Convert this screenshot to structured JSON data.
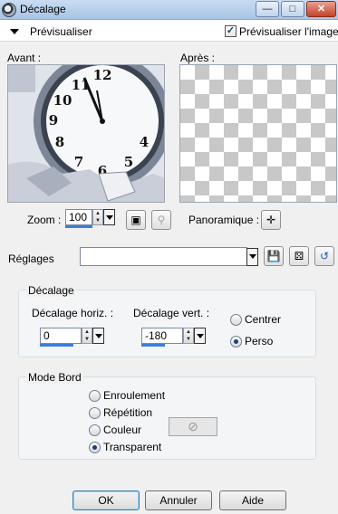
{
  "window": {
    "title": "Décalage"
  },
  "preview": {
    "toggle_label": "Prévisualiser",
    "show_image_label": "Prévisualiser l'image",
    "show_image_checked": true
  },
  "panes": {
    "before_label": "Avant :",
    "after_label": "Après :"
  },
  "zoom": {
    "label": "Zoom :",
    "value": "100"
  },
  "pan": {
    "label": "Panoramique :"
  },
  "presets": {
    "label": "Réglages",
    "value": ""
  },
  "offset": {
    "group_label": "Décalage",
    "horiz_label": "Décalage horiz. :",
    "horiz_value": "0",
    "vert_label": "Décalage vert. :",
    "vert_value": "-180",
    "options": [
      "Centrer",
      "Perso"
    ],
    "selected": "Perso"
  },
  "edge_mode": {
    "group_label": "Mode Bord",
    "options": [
      "Enroulement",
      "Répétition",
      "Couleur",
      "Transparent"
    ],
    "selected": "Transparent"
  },
  "buttons": {
    "ok": "OK",
    "cancel": "Annuler",
    "help": "Aide"
  },
  "colors": {
    "accent": "#3b7ddd",
    "checker": "#c8c8c8"
  }
}
